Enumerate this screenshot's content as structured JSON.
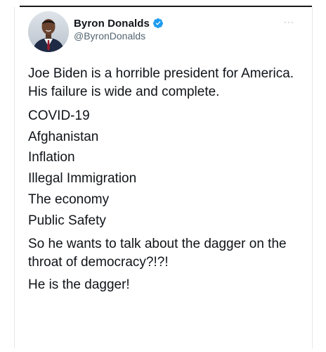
{
  "tweet": {
    "display_name": "Byron Donalds",
    "handle": "@ByronDonalds",
    "more_label": "···",
    "paragraph_1": "Joe Biden is a horrible president for America. His failure is wide and complete.",
    "list_items": [
      "COVID-19",
      "Afghanistan",
      "Inflation",
      "Illegal Immigration",
      "The economy",
      "Public Safety"
    ],
    "paragraph_2": "So he wants to talk about the dagger on the throat of democracy?!?!",
    "paragraph_3": "He is the dagger!"
  },
  "icons": {
    "verified": "verified-badge-icon",
    "more": "more-options-icon"
  },
  "colors": {
    "verified_blue": "#1d9bf0",
    "text_primary": "#0f1419",
    "text_secondary": "#536471"
  }
}
